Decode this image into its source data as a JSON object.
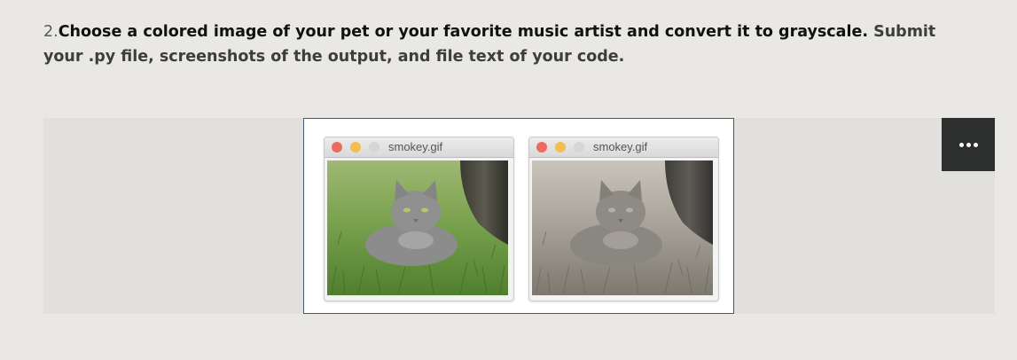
{
  "question": {
    "number": "2.",
    "instruction_bold": "Choose a colored image of your pet or your favorite music artist and convert it to grayscale.",
    "instruction_rest": " Submit your .py file, screenshots of the output, and file text of your code."
  },
  "figure": {
    "windows": [
      {
        "title": "smokey.gif",
        "variant": "color"
      },
      {
        "title": "smokey.gif",
        "variant": "grayscale"
      }
    ]
  },
  "toolbar": {
    "menu_icon": "more-horizontal-icon"
  },
  "colors": {
    "page_background": "#e9e8e5",
    "strip_background": "#e1e0dc",
    "figure_border": "#3d5a78",
    "menu_button": "#2d2f2e",
    "close_dot": "#ee6a5f",
    "minimize_dot": "#f5bd4f",
    "zoom_dot": "#d6d6d6"
  }
}
